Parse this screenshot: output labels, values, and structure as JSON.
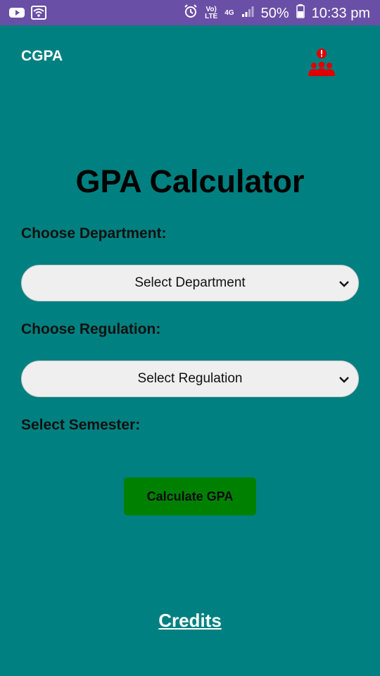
{
  "status_bar": {
    "network_label_top": "4G",
    "volte_top": "Vo)",
    "volte_bottom": "LTE",
    "battery_percent": "50%",
    "time": "10:33 pm",
    "icons": [
      "youtube-icon",
      "wifi-icon",
      "alarm-icon",
      "volte-icon",
      "signal-icon",
      "battery-icon"
    ]
  },
  "app_bar": {
    "title": "CGPA",
    "team_icon_color": "#e00000"
  },
  "main": {
    "heading": "GPA Calculator",
    "department_label": "Choose Department:",
    "department_select": "Select Department",
    "regulation_label": "Choose Regulation:",
    "regulation_select": "Select Regulation",
    "semester_label": "Select Semester:",
    "calculate_button": "Calculate GPA",
    "credits_link": "Credits"
  },
  "colors": {
    "background": "#008080",
    "status_bar": "#6a4fa6",
    "button": "#008000"
  }
}
